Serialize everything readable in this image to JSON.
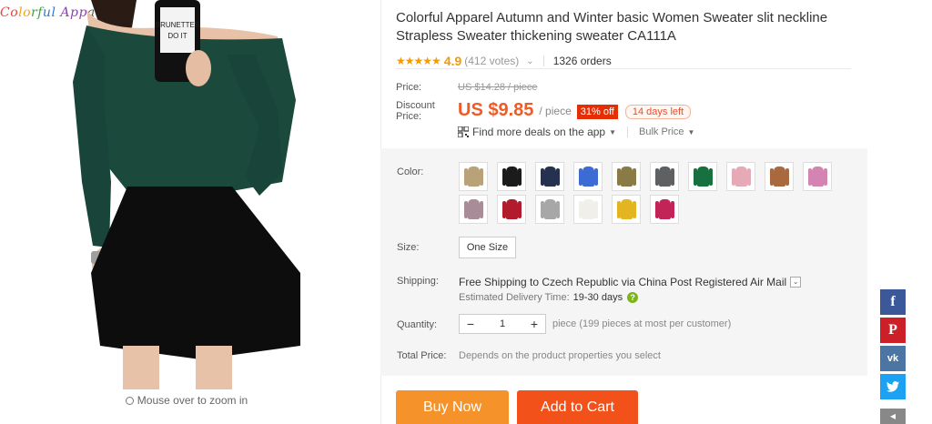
{
  "brand": {
    "logo_text": "Colorful Apparel",
    "trademark": "®"
  },
  "gallery": {
    "zoom_hint": "Mouse over to zoom in",
    "photo_alt": "Woman in dark green off-shoulder sweater and black skirt taking a mirror selfie"
  },
  "product": {
    "title": "Colorful Apparel Autumn and Winter basic Women Sweater slit neckline Strapless Sweater thickening sweater CA111A",
    "stars": "★★★★★",
    "rating": "4.9",
    "votes": "(412 votes)",
    "orders": "1326 orders"
  },
  "price": {
    "price_label": "Price:",
    "original_price": "US $14.28 / piece",
    "discount_label_1": "Discount",
    "discount_label_2": "Price:",
    "discount_price": "US $9.85",
    "per_piece": "/ piece",
    "off_badge": "31% off",
    "days_left": "14 days left",
    "app_deals": "Find more deals on the app",
    "bulk_price": "Bulk Price"
  },
  "options": {
    "color_label": "Color:",
    "colors": [
      {
        "name": "khaki",
        "hex": "#b9a277"
      },
      {
        "name": "black",
        "hex": "#1b1b1b"
      },
      {
        "name": "navy",
        "hex": "#26314f"
      },
      {
        "name": "royal-blue",
        "hex": "#3d6bd4"
      },
      {
        "name": "olive",
        "hex": "#8a7a45"
      },
      {
        "name": "dark-gray",
        "hex": "#5f6062"
      },
      {
        "name": "green",
        "hex": "#17703f"
      },
      {
        "name": "light-pink",
        "hex": "#e6aab6"
      },
      {
        "name": "camel",
        "hex": "#a8693e"
      },
      {
        "name": "pink",
        "hex": "#d484b3"
      },
      {
        "name": "mauve",
        "hex": "#a88c97"
      },
      {
        "name": "wine-red",
        "hex": "#b11b2b"
      },
      {
        "name": "light-gray",
        "hex": "#a7a7a7"
      },
      {
        "name": "white",
        "hex": "#f0efea"
      },
      {
        "name": "yellow",
        "hex": "#e3b521"
      },
      {
        "name": "rose-red",
        "hex": "#c22457"
      }
    ],
    "size_label": "Size:",
    "size_value": "One Size",
    "shipping_label": "Shipping:",
    "shipping_free": "Free Shipping to Czech Republic via China Post Registered Air Mail",
    "delivery_label": "Estimated Delivery Time:",
    "delivery_days": "19-30 days",
    "quantity_label": "Quantity:",
    "quantity_value": "1",
    "quantity_minus": "−",
    "quantity_plus": "+",
    "quantity_note": "piece (199 pieces at most per customer)",
    "total_label": "Total Price:",
    "total_note": "Depends on the product properties you select"
  },
  "actions": {
    "buy_now": "Buy Now",
    "add_to_cart": "Add to Cart"
  },
  "social": {
    "facebook": "f",
    "pinterest": "P",
    "vk": "vk",
    "twitter": "🐦"
  }
}
